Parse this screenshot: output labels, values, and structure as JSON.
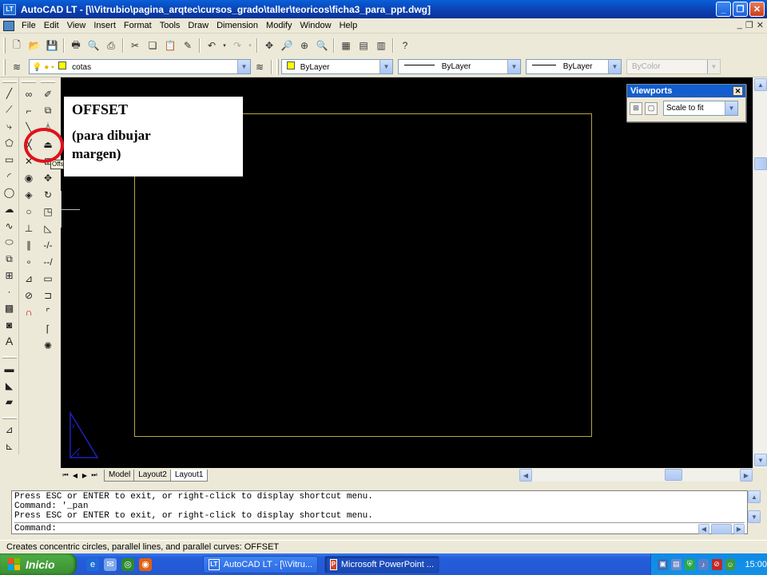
{
  "window": {
    "app_icon": "LT",
    "title": "AutoCAD LT - [\\\\Vitrubio\\pagina_arqtec\\cursos_grado\\taller\\teoricos\\ficha3_para_ppt.dwg]",
    "buttons": [
      "minimize-icon",
      "restore-icon",
      "close-icon"
    ]
  },
  "menu": {
    "items": [
      "File",
      "Edit",
      "View",
      "Insert",
      "Format",
      "Tools",
      "Draw",
      "Dimension",
      "Modify",
      "Window",
      "Help"
    ]
  },
  "layers": {
    "current_layer": "cotas",
    "color": "ByLayer",
    "linetype": "ByLayer",
    "lineweight": "ByLayer",
    "plotstyle": "ByColor"
  },
  "viewports": {
    "title": "Viewports",
    "scale": "Scale to fit"
  },
  "callout": {
    "title": "OFFSET",
    "body": "(para dibujar margen)"
  },
  "tooltip_fragment": "Offs",
  "tabs": {
    "items": [
      "Model",
      "Layout2",
      "Layout1"
    ],
    "active": "Layout1"
  },
  "command": {
    "lines": [
      "Press ESC or ENTER to exit, or right-click to display shortcut menu.",
      "Command: '_pan",
      "Press ESC or ENTER to exit, or right-click to display shortcut menu."
    ],
    "prompt": "Command:"
  },
  "status": {
    "text": "Creates concentric circles, parallel lines, and parallel curves:  OFFSET"
  },
  "taskbar": {
    "start_label": "Inicio",
    "items": [
      {
        "label": "AutoCAD LT - [\\\\Vitru...",
        "icon": "LT"
      },
      {
        "label": "Microsoft PowerPoint ...",
        "icon": "P"
      }
    ],
    "clock": "15:00"
  },
  "colors": {
    "drawing_bg": "#000000",
    "border_line": "#b5a742",
    "highlight_circle": "#e0121b",
    "ucs_icon": "#2020c0"
  }
}
